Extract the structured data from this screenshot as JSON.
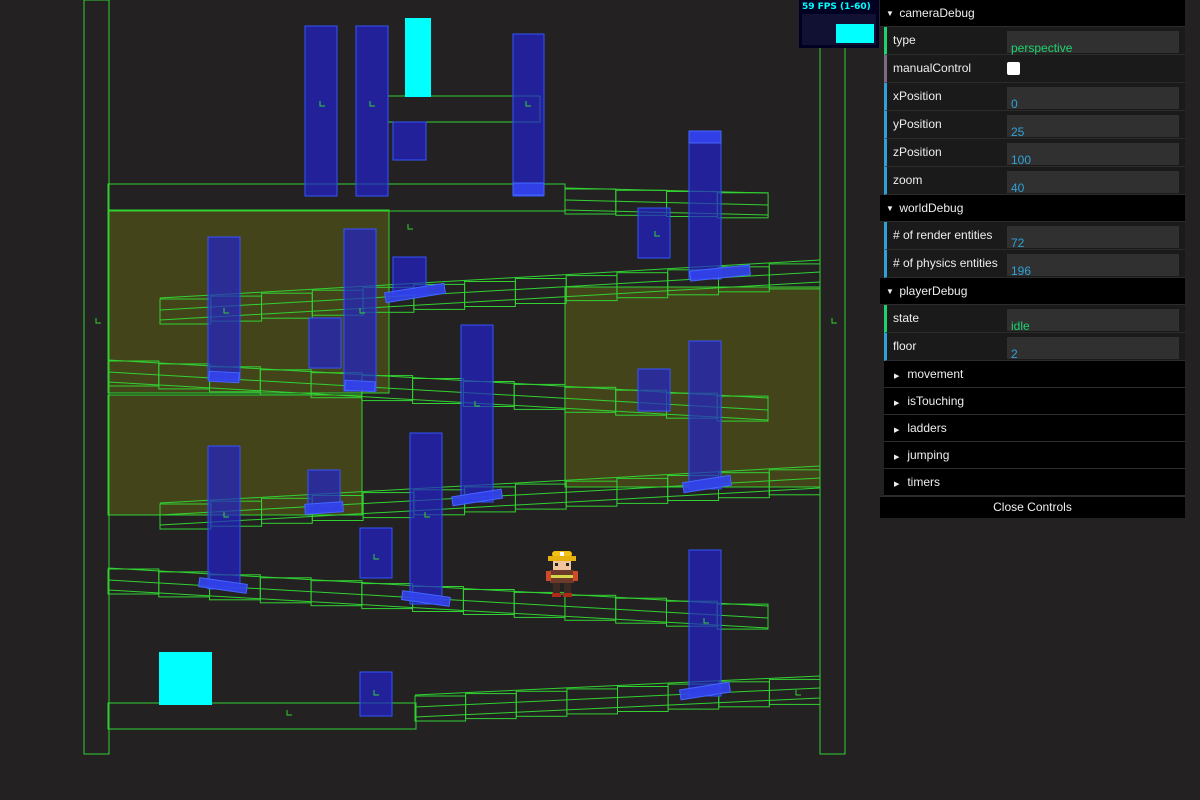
{
  "stats": {
    "fps_text": "59 FPS (1-60)",
    "fps": 59,
    "min": 1,
    "max": 60
  },
  "gui": {
    "camera": {
      "title": "cameraDebug",
      "type_label": "type",
      "type_value": "perspective",
      "manual_label": "manualControl",
      "manual_value": false,
      "x_label": "xPosition",
      "x_value": "0",
      "y_label": "yPosition",
      "y_value": "25",
      "z_label": "zPosition",
      "z_value": "100",
      "zoom_label": "zoom",
      "zoom_value": "40"
    },
    "world": {
      "title": "worldDebug",
      "render_label": "# of render entities",
      "render_value": "72",
      "physics_label": "# of physics entities",
      "physics_value": "196"
    },
    "player": {
      "title": "playerDebug",
      "state_label": "state",
      "state_value": "idle",
      "floor_label": "floor",
      "floor_value": "2",
      "subfolders": [
        "movement",
        "isTouching",
        "ladders",
        "jumping",
        "timers"
      ]
    },
    "close_label": "Close Controls"
  },
  "colors": {
    "background": "#232122",
    "wireframe": "#32d132",
    "ladder": "#2222cc",
    "highlight": "#00ffff",
    "zone": "#4a4a1a"
  },
  "icons": {
    "expanded": "triangle-down-icon",
    "collapsed": "triangle-right-icon"
  }
}
